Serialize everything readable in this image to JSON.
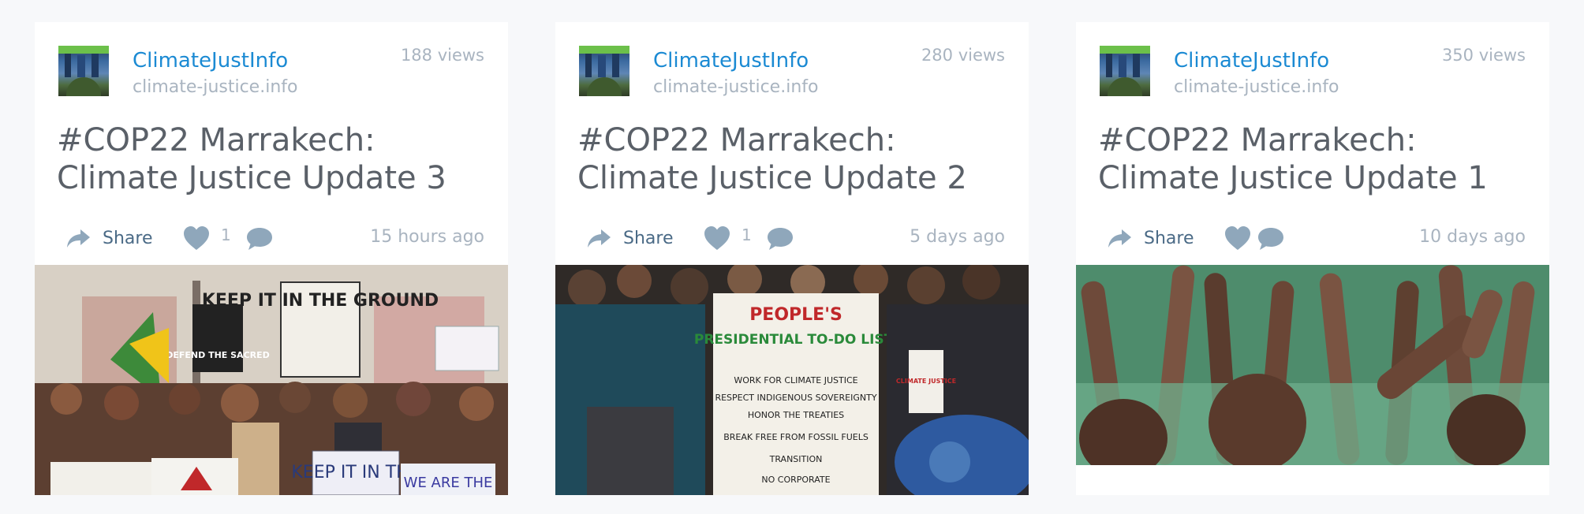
{
  "cards": [
    {
      "source_name": "ClimateJustInfo",
      "source_domain": "climate-justice.info",
      "views": "188 views",
      "title": "#COP22 Marrakech: Climate Justice Update 3",
      "share_label": "Share",
      "like_count": "1",
      "time_ago": "15 hours ago",
      "photo_text": [
        "KEEP IT IN THE GROUND",
        "DEFEND THE SACRED",
        "KEEP IT IN THE",
        "WE ARE THE"
      ]
    },
    {
      "source_name": "ClimateJustInfo",
      "source_domain": "climate-justice.info",
      "views": "280 views",
      "title": "#COP22 Marrakech: Climate Justice Update 2",
      "share_label": "Share",
      "like_count": "1",
      "time_ago": "5 days ago",
      "photo_text": [
        "PEOPLE'S",
        "PRESIDENTIAL TO-DO LIST:",
        "WORK FOR CLIMATE JUSTICE",
        "RESPECT INDIGENOUS SOVEREIGNTY",
        "HONOR THE TREATIES",
        "BREAK FREE FROM FOSSIL FUELS",
        "TRANSITION",
        "NO CORPORATE",
        "CLIMATE JUSTICE"
      ]
    },
    {
      "source_name": "ClimateJustInfo",
      "source_domain": "climate-justice.info",
      "views": "350 views",
      "title": "#COP22 Marrakech: Climate Justice Update 1",
      "share_label": "Share",
      "like_count": "",
      "time_ago": "10 days ago",
      "photo_text": []
    }
  ],
  "icons": {
    "share": "share-arrow-icon",
    "like": "heart-icon",
    "comment": "speech-bubble-icon"
  },
  "colors": {
    "link": "#1b8ad3",
    "muted": "#a9b4c0",
    "title": "#5a6068",
    "action": "#4a6a86",
    "icon": "#8fa7bb"
  }
}
